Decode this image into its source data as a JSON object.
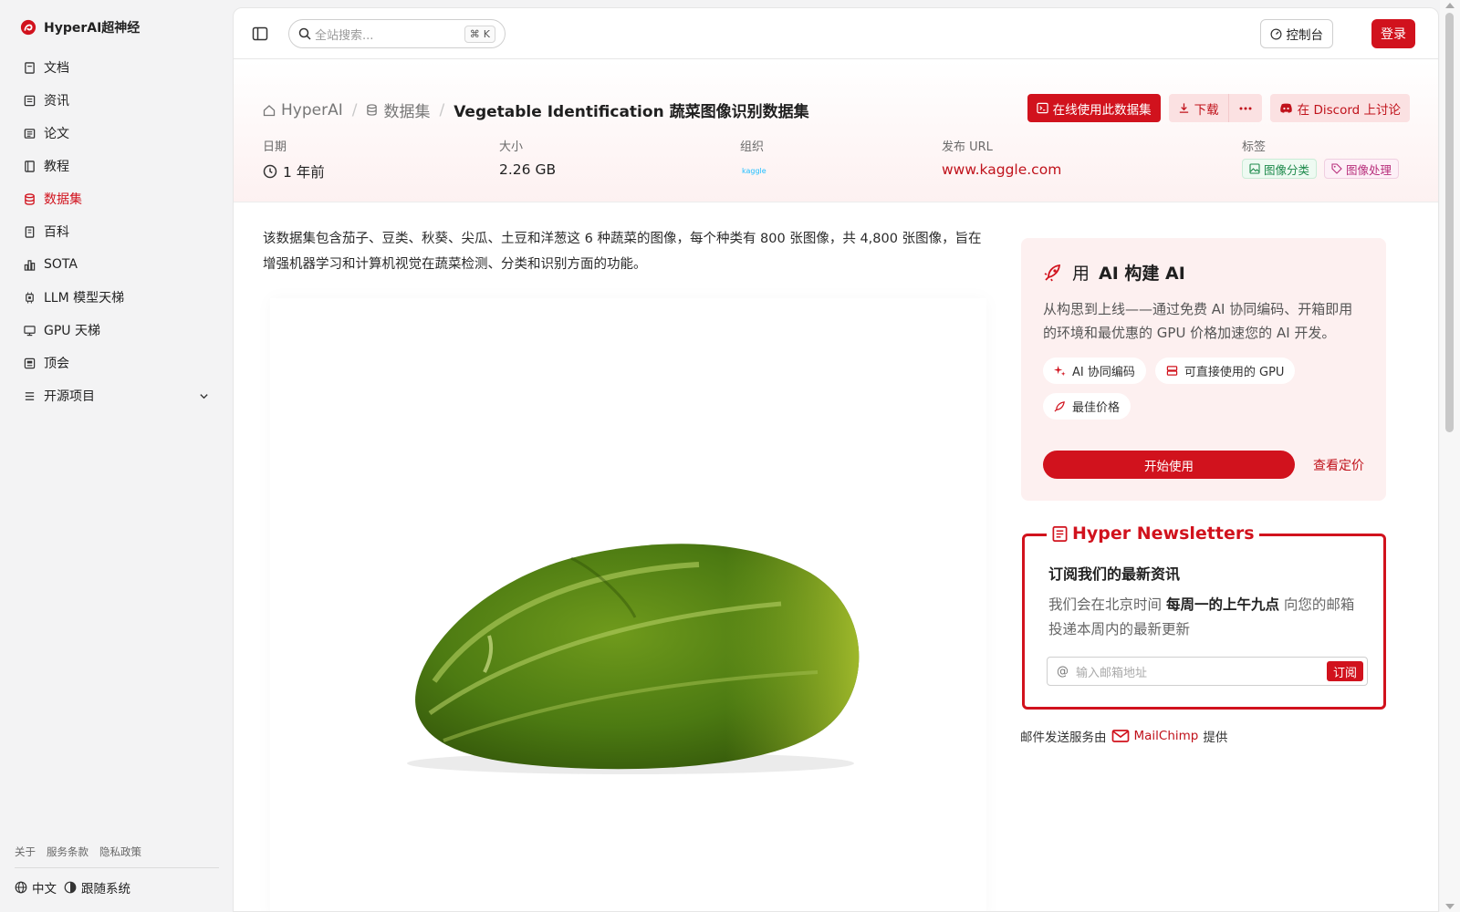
{
  "brand": {
    "name": "HyperAI超神经",
    "accent": "#d1121d"
  },
  "sidebar": {
    "items": [
      {
        "label": "文档",
        "icon": "book-icon"
      },
      {
        "label": "资讯",
        "icon": "newspaper-icon"
      },
      {
        "label": "论文",
        "icon": "paper-icon"
      },
      {
        "label": "教程",
        "icon": "notebook-icon"
      },
      {
        "label": "数据集",
        "icon": "database-icon",
        "active": true
      },
      {
        "label": "百科",
        "icon": "encyclopedia-icon"
      },
      {
        "label": "SOTA",
        "icon": "bar-chart-icon"
      },
      {
        "label": "LLM 模型天梯",
        "icon": "chip-icon"
      },
      {
        "label": "GPU 天梯",
        "icon": "monitor-icon"
      },
      {
        "label": "顶会",
        "icon": "conference-icon"
      },
      {
        "label": "开源项目",
        "icon": "list-icon",
        "expandable": true
      }
    ],
    "footer_links": [
      "关于",
      "服务条款",
      "隐私政策"
    ],
    "language": "中文",
    "theme": "跟随系统"
  },
  "topbar": {
    "search_placeholder": "全站搜索...",
    "search_shortcut": "K",
    "console_label": "控制台",
    "login_label": "登录"
  },
  "breadcrumb": {
    "home": "HyperAI",
    "section": "数据集",
    "title": "Vegetable Identification 蔬菜图像识别数据集"
  },
  "actions": {
    "use_online": "在线使用此数据集",
    "download": "下载",
    "discord": "在 Discord 上讨论"
  },
  "meta": {
    "date_label": "日期",
    "date_value": "1 年前",
    "size_label": "大小",
    "size_value": "2.26 GB",
    "org_label": "组织",
    "org_logo_text": "kaggle",
    "url_label": "发布 URL",
    "url_value": "www.kaggle.com",
    "tags_label": "标签",
    "tags": [
      "图像分类",
      "图像处理"
    ]
  },
  "description": "该数据集包含茄子、豆类、秋葵、尖瓜、土豆和洋葱这 6 种蔬菜的图像，每个种类有 800 张图像，共 4,800 张图像，旨在增强机器学习和计算机视觉在蔬菜检测、分类和识别方面的功能。",
  "ai_card": {
    "title_prefix": "用",
    "title_bold": "AI 构建 AI",
    "desc": "从构思到上线——通过免费 AI 协同编码、开箱即用的环境和最优惠的 GPU 价格加速您的 AI 开发。",
    "chips": [
      "AI 协同编码",
      "可直接使用的 GPU",
      "最佳价格"
    ],
    "start_label": "开始使用",
    "pricing_label": "查看定价"
  },
  "newsletter": {
    "title": "Hyper Newsletters",
    "subtitle": "订阅我们的最新资讯",
    "desc_pre": "我们会在北京时间",
    "desc_bold": "每周一的上午九点",
    "desc_post": "向您的邮箱投递本周内的最新更新",
    "email_placeholder": "输入邮箱地址",
    "subscribe_label": "订阅",
    "credit_pre": "邮件发送服务由",
    "credit_brand": "MailChimp",
    "credit_post": "提供"
  }
}
